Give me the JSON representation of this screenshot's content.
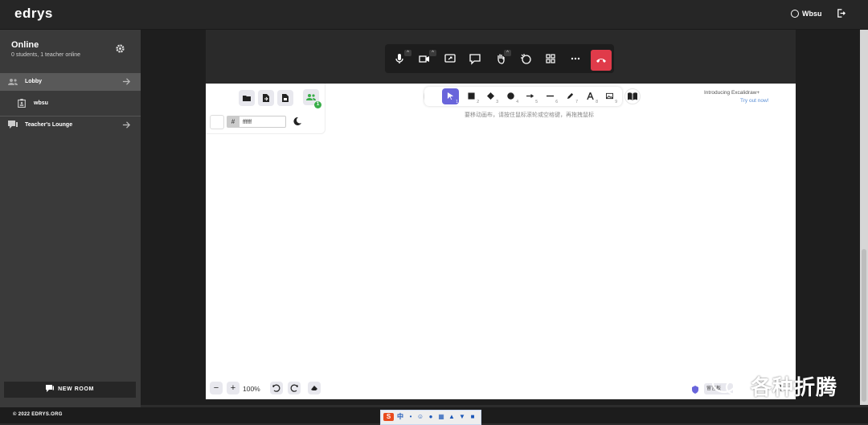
{
  "app": {
    "logo": "edrys"
  },
  "header": {
    "username": "Wbsu"
  },
  "sidebar": {
    "title": "Online",
    "subtitle": "0 students, 1 teacher online",
    "rooms": [
      {
        "label": "Lobby",
        "active": true
      },
      {
        "label": "wbsu"
      },
      {
        "label": "Teacher's Lounge"
      }
    ],
    "new_room_label": "NEW ROOM",
    "copyright": "© 2022 EDRYS.ORG"
  },
  "callbar": {
    "icons": [
      "microphone-icon",
      "camera-icon",
      "screen-share-icon",
      "chat-icon",
      "raise-hand-icon",
      "reactions-icon",
      "tile-view-icon",
      "more-icon",
      "hangup-icon"
    ]
  },
  "canvas": {
    "hex_prefix": "#",
    "background_hex": "ffffff",
    "tool_keys": [
      "1",
      "2",
      "3",
      "4",
      "5",
      "6",
      "7",
      "8",
      "9"
    ],
    "hint": "要移动画布，请按住鼠标滚轮或空格键，再拖拽鼠标",
    "intro_title": "Introducing Excalidraw+",
    "intro_link": "Try out now!",
    "zoom": "100%",
    "help_label": "留言板",
    "help_symbol": "?",
    "collaborators_count": "1",
    "accent": "#6965db"
  },
  "taskbar": {
    "ime_label": "中"
  },
  "watermark": {
    "text": "各种折腾"
  }
}
